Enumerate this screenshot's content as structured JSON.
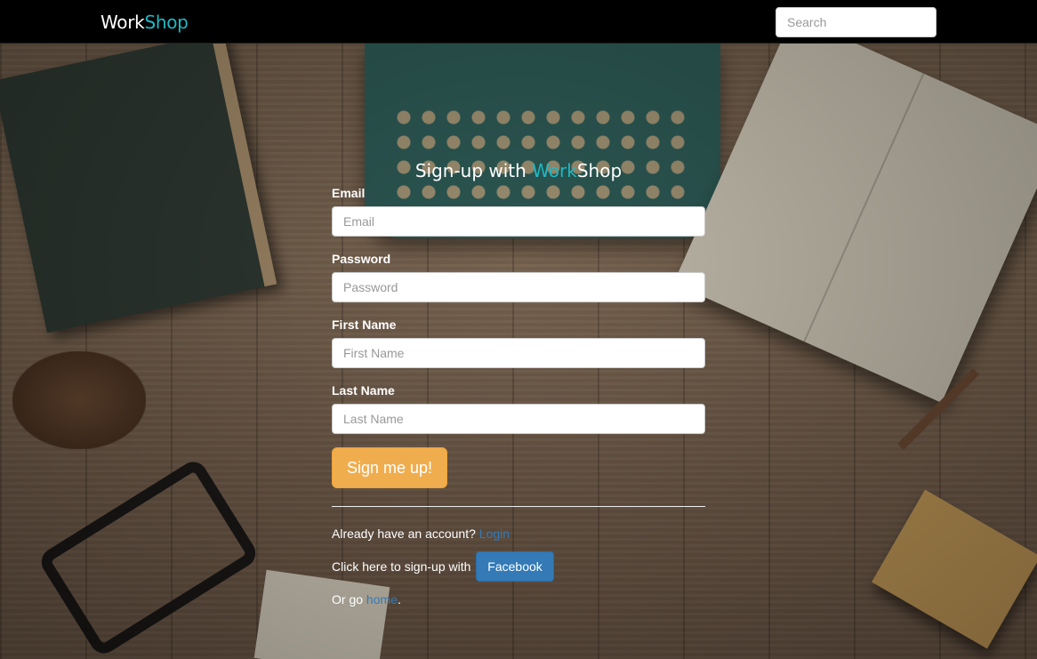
{
  "navbar": {
    "brand_part1": "Work",
    "brand_part2": "Shop",
    "search_placeholder": "Search"
  },
  "form": {
    "heading_prefix": "Sign-up with ",
    "heading_brand_part1": "Work",
    "heading_brand_part2": "Shop",
    "fields": [
      {
        "label": "Email",
        "placeholder": "Email",
        "value": ""
      },
      {
        "label": "Password",
        "placeholder": "Password",
        "value": ""
      },
      {
        "label": "First Name",
        "placeholder": "First Name",
        "value": ""
      },
      {
        "label": "Last Name",
        "placeholder": "Last Name",
        "value": ""
      }
    ],
    "submit_label": "Sign me up!"
  },
  "footer_links": {
    "account_text": "Already have an account? ",
    "login_link": "Login",
    "facebook_text": "Click here to sign-up with ",
    "facebook_button": "Facebook",
    "home_prefix": "Or go ",
    "home_link": "home",
    "home_suffix": "."
  },
  "colors": {
    "brand_accent": "#1fb8c4",
    "navbar_bg": "#000000",
    "submit_bg": "#f0ad4e",
    "facebook_bg": "#337ab7",
    "link": "#337ab7"
  }
}
